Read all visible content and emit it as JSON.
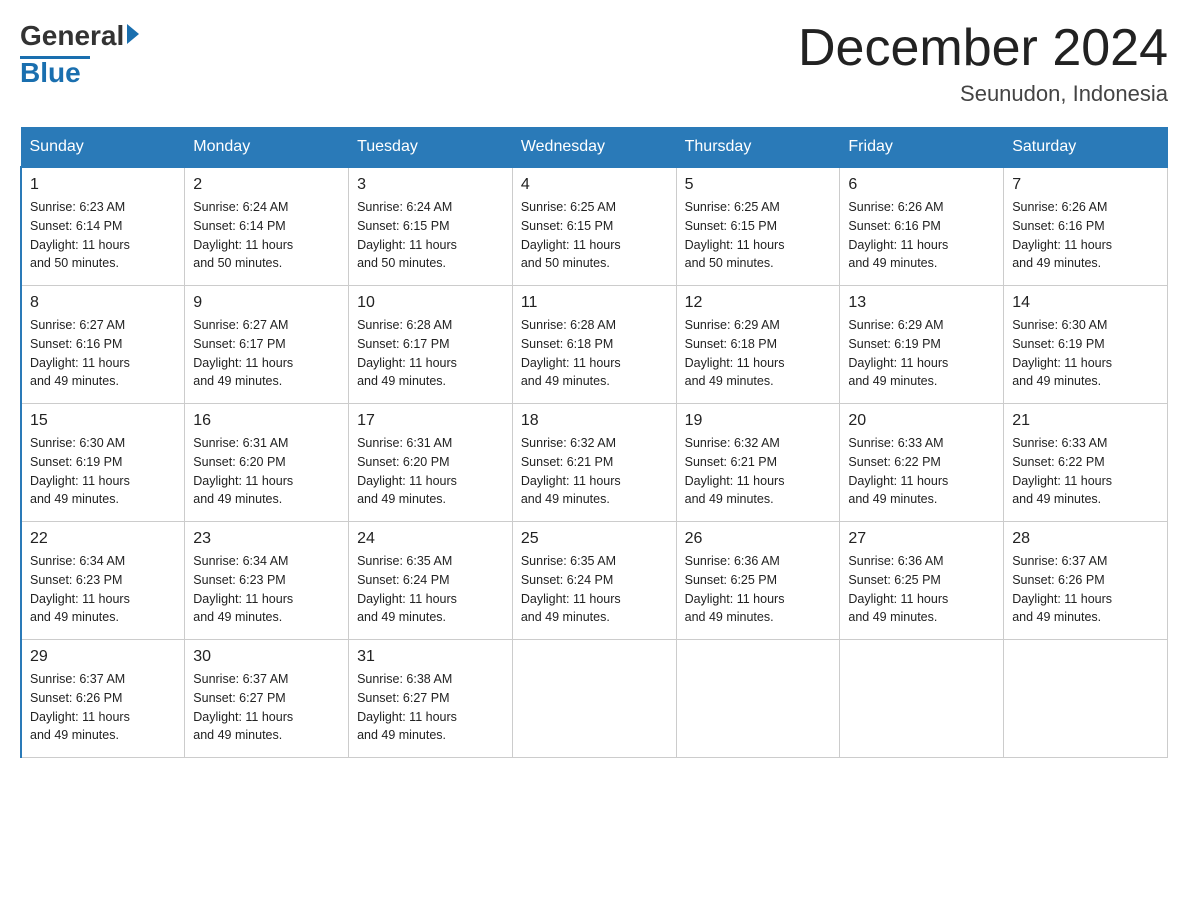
{
  "logo": {
    "general": "General",
    "blue": "Blue"
  },
  "title": "December 2024",
  "location": "Seunudon, Indonesia",
  "days_of_week": [
    "Sunday",
    "Monday",
    "Tuesday",
    "Wednesday",
    "Thursday",
    "Friday",
    "Saturday"
  ],
  "weeks": [
    [
      {
        "day": "1",
        "sunrise": "6:23 AM",
        "sunset": "6:14 PM",
        "daylight": "11 hours and 50 minutes."
      },
      {
        "day": "2",
        "sunrise": "6:24 AM",
        "sunset": "6:14 PM",
        "daylight": "11 hours and 50 minutes."
      },
      {
        "day": "3",
        "sunrise": "6:24 AM",
        "sunset": "6:15 PM",
        "daylight": "11 hours and 50 minutes."
      },
      {
        "day": "4",
        "sunrise": "6:25 AM",
        "sunset": "6:15 PM",
        "daylight": "11 hours and 50 minutes."
      },
      {
        "day": "5",
        "sunrise": "6:25 AM",
        "sunset": "6:15 PM",
        "daylight": "11 hours and 50 minutes."
      },
      {
        "day": "6",
        "sunrise": "6:26 AM",
        "sunset": "6:16 PM",
        "daylight": "11 hours and 49 minutes."
      },
      {
        "day": "7",
        "sunrise": "6:26 AM",
        "sunset": "6:16 PM",
        "daylight": "11 hours and 49 minutes."
      }
    ],
    [
      {
        "day": "8",
        "sunrise": "6:27 AM",
        "sunset": "6:16 PM",
        "daylight": "11 hours and 49 minutes."
      },
      {
        "day": "9",
        "sunrise": "6:27 AM",
        "sunset": "6:17 PM",
        "daylight": "11 hours and 49 minutes."
      },
      {
        "day": "10",
        "sunrise": "6:28 AM",
        "sunset": "6:17 PM",
        "daylight": "11 hours and 49 minutes."
      },
      {
        "day": "11",
        "sunrise": "6:28 AM",
        "sunset": "6:18 PM",
        "daylight": "11 hours and 49 minutes."
      },
      {
        "day": "12",
        "sunrise": "6:29 AM",
        "sunset": "6:18 PM",
        "daylight": "11 hours and 49 minutes."
      },
      {
        "day": "13",
        "sunrise": "6:29 AM",
        "sunset": "6:19 PM",
        "daylight": "11 hours and 49 minutes."
      },
      {
        "day": "14",
        "sunrise": "6:30 AM",
        "sunset": "6:19 PM",
        "daylight": "11 hours and 49 minutes."
      }
    ],
    [
      {
        "day": "15",
        "sunrise": "6:30 AM",
        "sunset": "6:19 PM",
        "daylight": "11 hours and 49 minutes."
      },
      {
        "day": "16",
        "sunrise": "6:31 AM",
        "sunset": "6:20 PM",
        "daylight": "11 hours and 49 minutes."
      },
      {
        "day": "17",
        "sunrise": "6:31 AM",
        "sunset": "6:20 PM",
        "daylight": "11 hours and 49 minutes."
      },
      {
        "day": "18",
        "sunrise": "6:32 AM",
        "sunset": "6:21 PM",
        "daylight": "11 hours and 49 minutes."
      },
      {
        "day": "19",
        "sunrise": "6:32 AM",
        "sunset": "6:21 PM",
        "daylight": "11 hours and 49 minutes."
      },
      {
        "day": "20",
        "sunrise": "6:33 AM",
        "sunset": "6:22 PM",
        "daylight": "11 hours and 49 minutes."
      },
      {
        "day": "21",
        "sunrise": "6:33 AM",
        "sunset": "6:22 PM",
        "daylight": "11 hours and 49 minutes."
      }
    ],
    [
      {
        "day": "22",
        "sunrise": "6:34 AM",
        "sunset": "6:23 PM",
        "daylight": "11 hours and 49 minutes."
      },
      {
        "day": "23",
        "sunrise": "6:34 AM",
        "sunset": "6:23 PM",
        "daylight": "11 hours and 49 minutes."
      },
      {
        "day": "24",
        "sunrise": "6:35 AM",
        "sunset": "6:24 PM",
        "daylight": "11 hours and 49 minutes."
      },
      {
        "day": "25",
        "sunrise": "6:35 AM",
        "sunset": "6:24 PM",
        "daylight": "11 hours and 49 minutes."
      },
      {
        "day": "26",
        "sunrise": "6:36 AM",
        "sunset": "6:25 PM",
        "daylight": "11 hours and 49 minutes."
      },
      {
        "day": "27",
        "sunrise": "6:36 AM",
        "sunset": "6:25 PM",
        "daylight": "11 hours and 49 minutes."
      },
      {
        "day": "28",
        "sunrise": "6:37 AM",
        "sunset": "6:26 PM",
        "daylight": "11 hours and 49 minutes."
      }
    ],
    [
      {
        "day": "29",
        "sunrise": "6:37 AM",
        "sunset": "6:26 PM",
        "daylight": "11 hours and 49 minutes."
      },
      {
        "day": "30",
        "sunrise": "6:37 AM",
        "sunset": "6:27 PM",
        "daylight": "11 hours and 49 minutes."
      },
      {
        "day": "31",
        "sunrise": "6:38 AM",
        "sunset": "6:27 PM",
        "daylight": "11 hours and 49 minutes."
      },
      null,
      null,
      null,
      null
    ]
  ],
  "labels": {
    "sunrise": "Sunrise:",
    "sunset": "Sunset:",
    "daylight": "Daylight:"
  },
  "colors": {
    "header_bg": "#2a7ab8",
    "header_text": "#ffffff",
    "border": "#2a7ab8"
  }
}
